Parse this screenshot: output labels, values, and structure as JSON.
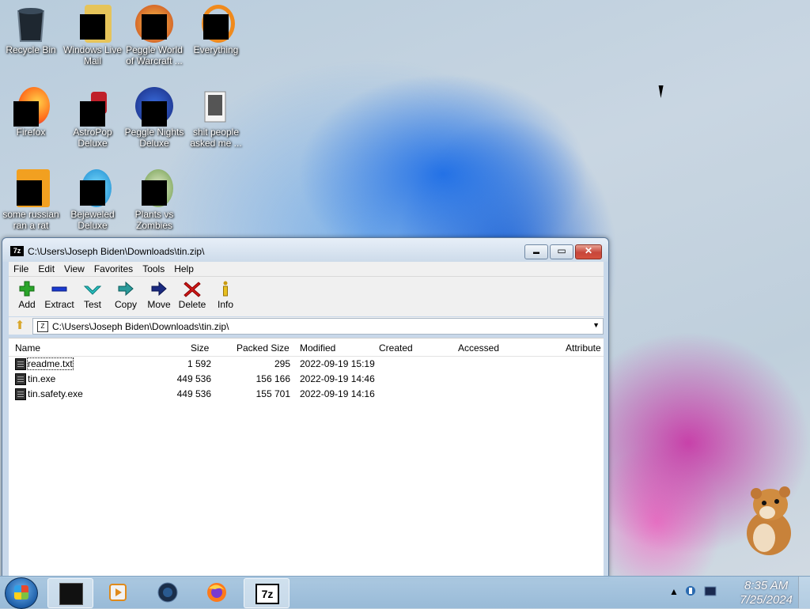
{
  "desktop": {
    "icons": [
      {
        "label": "Recycle Bin"
      },
      {
        "label": "Windows Live Mail"
      },
      {
        "label": "Peggle World of Warcraft ..."
      },
      {
        "label": "Everything"
      },
      {
        "label": "Firefox"
      },
      {
        "label": "AstroPop Deluxe"
      },
      {
        "label": "Peggle Nights Deluxe"
      },
      {
        "label": "shit people asked me ..."
      },
      {
        "label": "some russian ran a rat"
      },
      {
        "label": "Bejeweled Deluxe"
      },
      {
        "label": "Plants vs Zombies"
      }
    ]
  },
  "window": {
    "title": "C:\\Users\\Joseph Biden\\Downloads\\tin.zip\\",
    "app_icon_text": "7z",
    "close_glyph": "✕",
    "min_glyph": "▬",
    "max_glyph": "▭",
    "menu": [
      "File",
      "Edit",
      "View",
      "Favorites",
      "Tools",
      "Help"
    ],
    "toolbar": [
      "Add",
      "Extract",
      "Test",
      "Copy",
      "Move",
      "Delete",
      "Info"
    ],
    "address": "C:\\Users\\Joseph Biden\\Downloads\\tin.zip\\",
    "columns": [
      "Name",
      "Size",
      "Packed Size",
      "Modified",
      "Created",
      "Accessed",
      "Attribute"
    ],
    "files": [
      {
        "name": "readme.txt",
        "size": "1 592",
        "packed": "295",
        "modified": "2022-09-19 15:19"
      },
      {
        "name": "tin.exe",
        "size": "449 536",
        "packed": "156 166",
        "modified": "2022-09-19 14:46"
      },
      {
        "name": "tin.safety.exe",
        "size": "449 536",
        "packed": "155 701",
        "modified": "2022-09-19 14:16"
      }
    ]
  },
  "taskbar": {
    "app_7z_label": "7z",
    "clock_time": "8:35 AM",
    "clock_date": "7/25/2024"
  },
  "colors": {
    "close_red": "#c7463a",
    "add_green": "#2aa52a",
    "delete_red": "#d01818",
    "move_navy": "#1b2a80"
  }
}
